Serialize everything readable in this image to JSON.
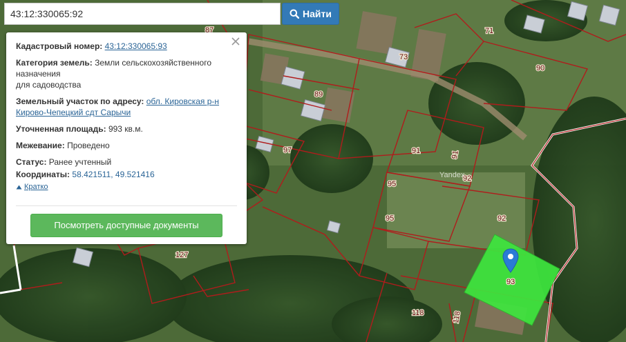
{
  "search": {
    "value": "43:12:330065:92",
    "button_label": "Найти",
    "button_icon": "search-icon"
  },
  "popup": {
    "cadastral_label": "Кадастровый номер:",
    "cadastral_value": "43:12:330065:93",
    "category_label": "Категория земель:",
    "category_value_line1": "Земли сельскохозяйственного",
    "category_value_line2": "назначения",
    "category_value_line3": "для садоводства",
    "address_label": "Земельный участок по адресу:",
    "address_value_line1": "обл. Кировская р-н",
    "address_value_line2": "Кирово-Чепецкий сдт Сарычи",
    "area_label": "Уточненная площадь:",
    "area_value": "993 кв.м.",
    "survey_label": "Межевание:",
    "survey_value": "Проведено",
    "status_label": "Статус:",
    "status_value": "Ранее учтенный",
    "coords_label": "Координаты:",
    "coords_value": "58.421511, 49.521416",
    "collapse_label": "Кратко",
    "documents_button": "Посмотреть доступные документы"
  },
  "map": {
    "attribution": "Yandex",
    "selected_plot_color": "#3ee63e",
    "boundary_color": "#b01c1c",
    "marker_color": "#2a7bd6",
    "plot_labels": [
      "87",
      "71",
      "73",
      "90",
      "89",
      "97",
      "91",
      "91",
      "92",
      "95",
      "95",
      "92",
      "93",
      "127",
      "118",
      "118"
    ]
  }
}
